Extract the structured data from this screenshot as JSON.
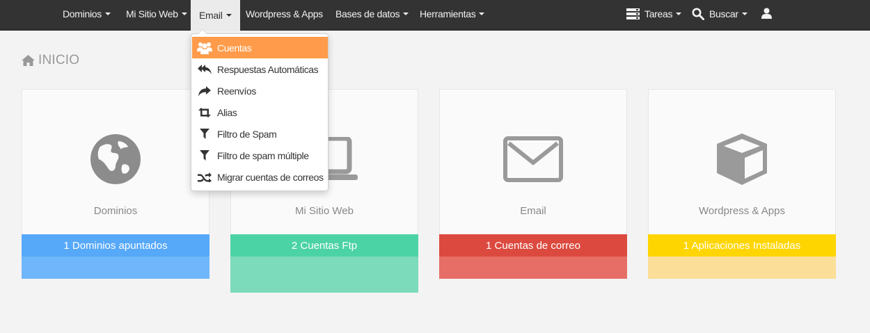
{
  "navbar": {
    "items": [
      {
        "label": "Dominios"
      },
      {
        "label": "Mi Sitio Web"
      },
      {
        "label": "Email"
      },
      {
        "label": "Wordpress & Apps"
      },
      {
        "label": "Bases de datos"
      },
      {
        "label": "Herramientas"
      }
    ],
    "right": {
      "tasks_label": "Tareas",
      "search_label": "Buscar"
    }
  },
  "email_menu": {
    "items": [
      {
        "label": "Cuentas",
        "icon": "users-icon"
      },
      {
        "label": "Respuestas Automáticas",
        "icon": "reply-all-icon"
      },
      {
        "label": "Reenvíos",
        "icon": "forward-icon"
      },
      {
        "label": "Alias",
        "icon": "retweet-icon"
      },
      {
        "label": "Filtro de Spam",
        "icon": "filter-icon"
      },
      {
        "label": "Filtro de spam múltiple",
        "icon": "filter-icon"
      },
      {
        "label": "Migrar cuentas de correos",
        "icon": "random-icon"
      }
    ],
    "highlight_color": "#ff9b4a"
  },
  "page": {
    "title": "INICIO"
  },
  "cards": [
    {
      "label": "Dominios",
      "status": "1 Dominios apuntados",
      "icon": "globe-icon",
      "color": "#56a8f9",
      "light": "#6fb6fa"
    },
    {
      "label": "Mi Sitio Web",
      "status": "2 Cuentas Ftp",
      "icon": "laptop-icon",
      "color": "#4cd3a5",
      "light": "#7bdbba"
    },
    {
      "label": "Email",
      "status": "1 Cuentas de correo",
      "icon": "envelope-icon",
      "color": "#dc4a3f",
      "light": "#e76e66"
    },
    {
      "label": "Wordpress & Apps",
      "status": "1 Aplicaciones Instaladas",
      "icon": "cube-icon",
      "color": "#ffd500",
      "light": "#fbdf99"
    }
  ]
}
